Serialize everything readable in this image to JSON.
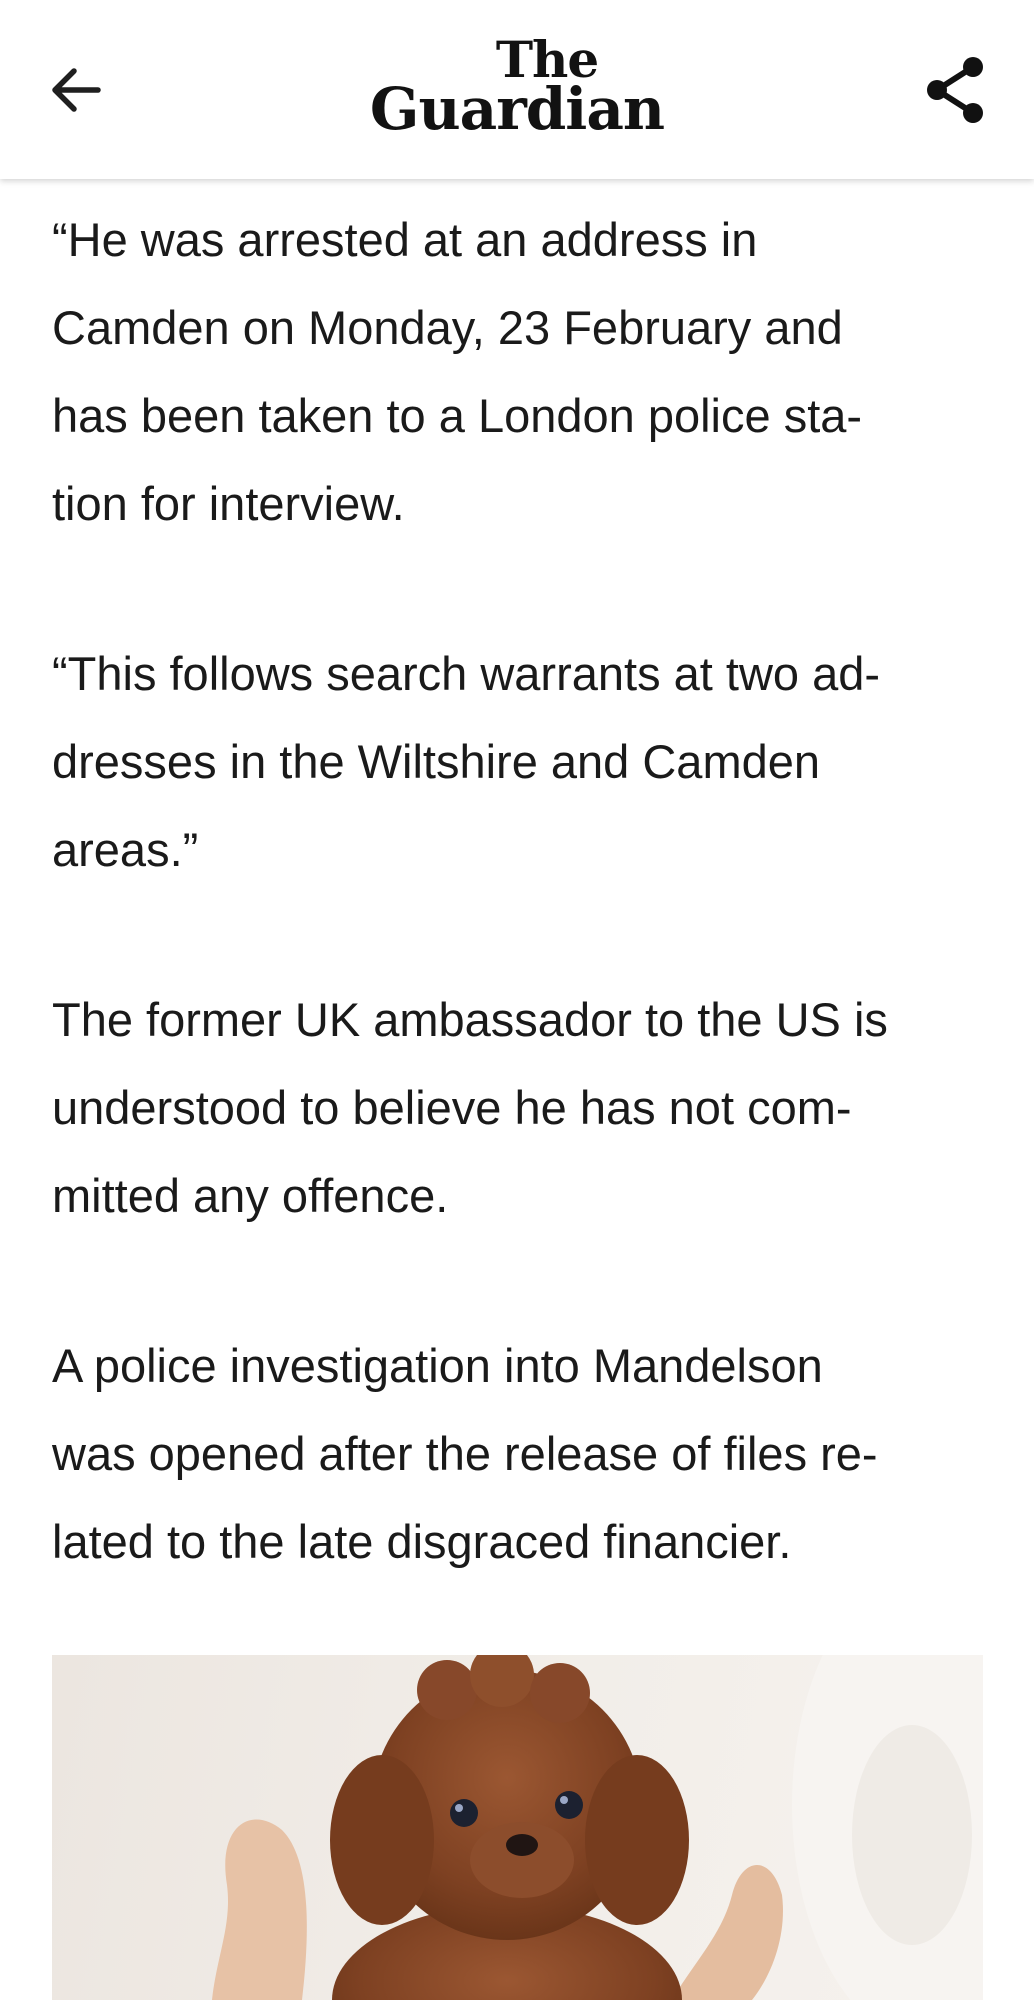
{
  "header": {
    "logo_line1": "The",
    "logo_line2": "Guardian"
  },
  "article": {
    "paragraphs": [
      "“He was arrested at an address in\nCamden on Monday, 23 February and\nhas been taken to a London police sta-\ntion for interview.",
      "“This follows search warrants at two ad-\ndresses in the Wiltshire and Camden\nareas.”",
      "The former UK ambassador to the US is\nunderstood to believe he has not com-\nmitted any offence.",
      "A police investigation into Mandelson\nwas opened after the release of files re-\nlated to the late disgraced financier."
    ]
  },
  "icons": {
    "back": "arrow-left-icon",
    "share": "share-icon"
  },
  "colors": {
    "text": "#1a1a1a",
    "background": "#ffffff",
    "puppy": "#8a4a26"
  }
}
